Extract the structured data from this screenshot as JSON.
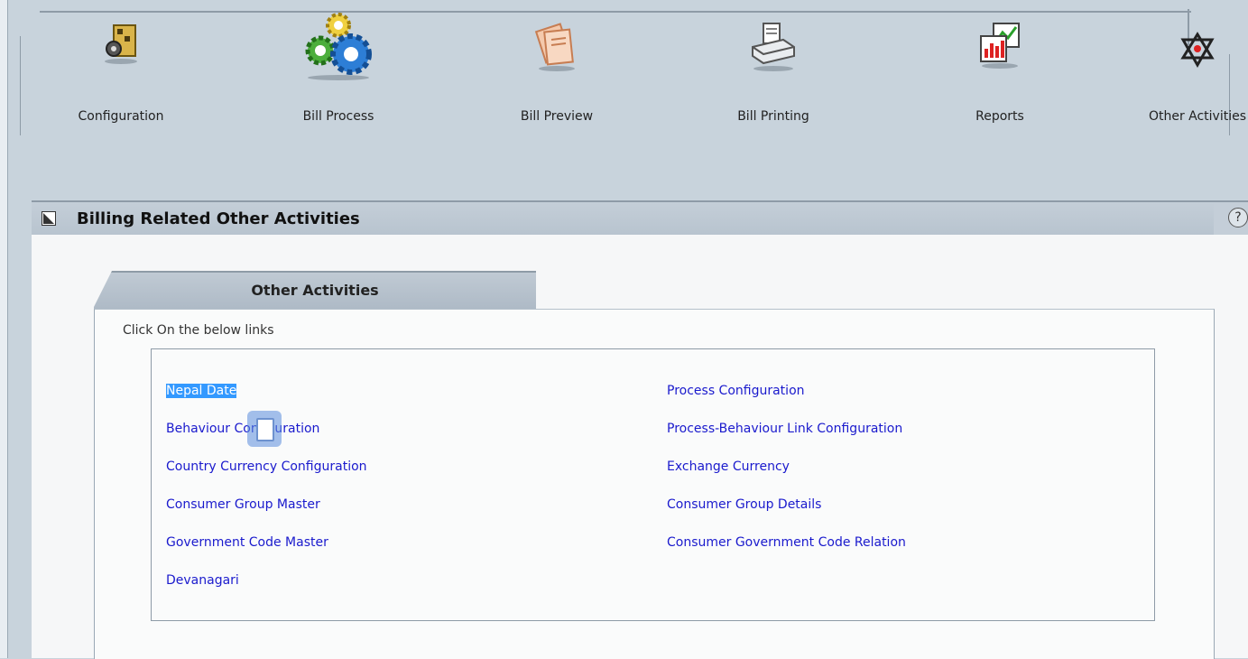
{
  "toolbar": {
    "items": [
      {
        "label": "Configuration",
        "icon": "configuration-icon"
      },
      {
        "label": "Bill Process",
        "icon": "gears-icon"
      },
      {
        "label": "Bill Preview",
        "icon": "documents-icon"
      },
      {
        "label": "Bill Printing",
        "icon": "printer-icon"
      },
      {
        "label": "Reports",
        "icon": "chart-report-icon"
      },
      {
        "label": "Other Activities",
        "icon": "other-activities-icon"
      }
    ]
  },
  "panel": {
    "title": "Billing Related Other Activities",
    "help_glyph": "?"
  },
  "tab": {
    "label": "Other Activities"
  },
  "instruction": "Click On the below links",
  "links": {
    "left": [
      "Nepal Date",
      "Behaviour Configuration",
      "Country Currency Configuration",
      "Consumer Group Master",
      "Government Code Master",
      "Devanagari"
    ],
    "right": [
      "Process Configuration",
      "Process-Behaviour Link Configuration",
      "Exchange Currency",
      "Consumer Group Details",
      "Consumer Government Code Relation"
    ],
    "selected": "Nepal Date"
  },
  "colors": {
    "link": "#1a1acd",
    "selection": "#3399ff",
    "background": "#c8d3dc"
  }
}
